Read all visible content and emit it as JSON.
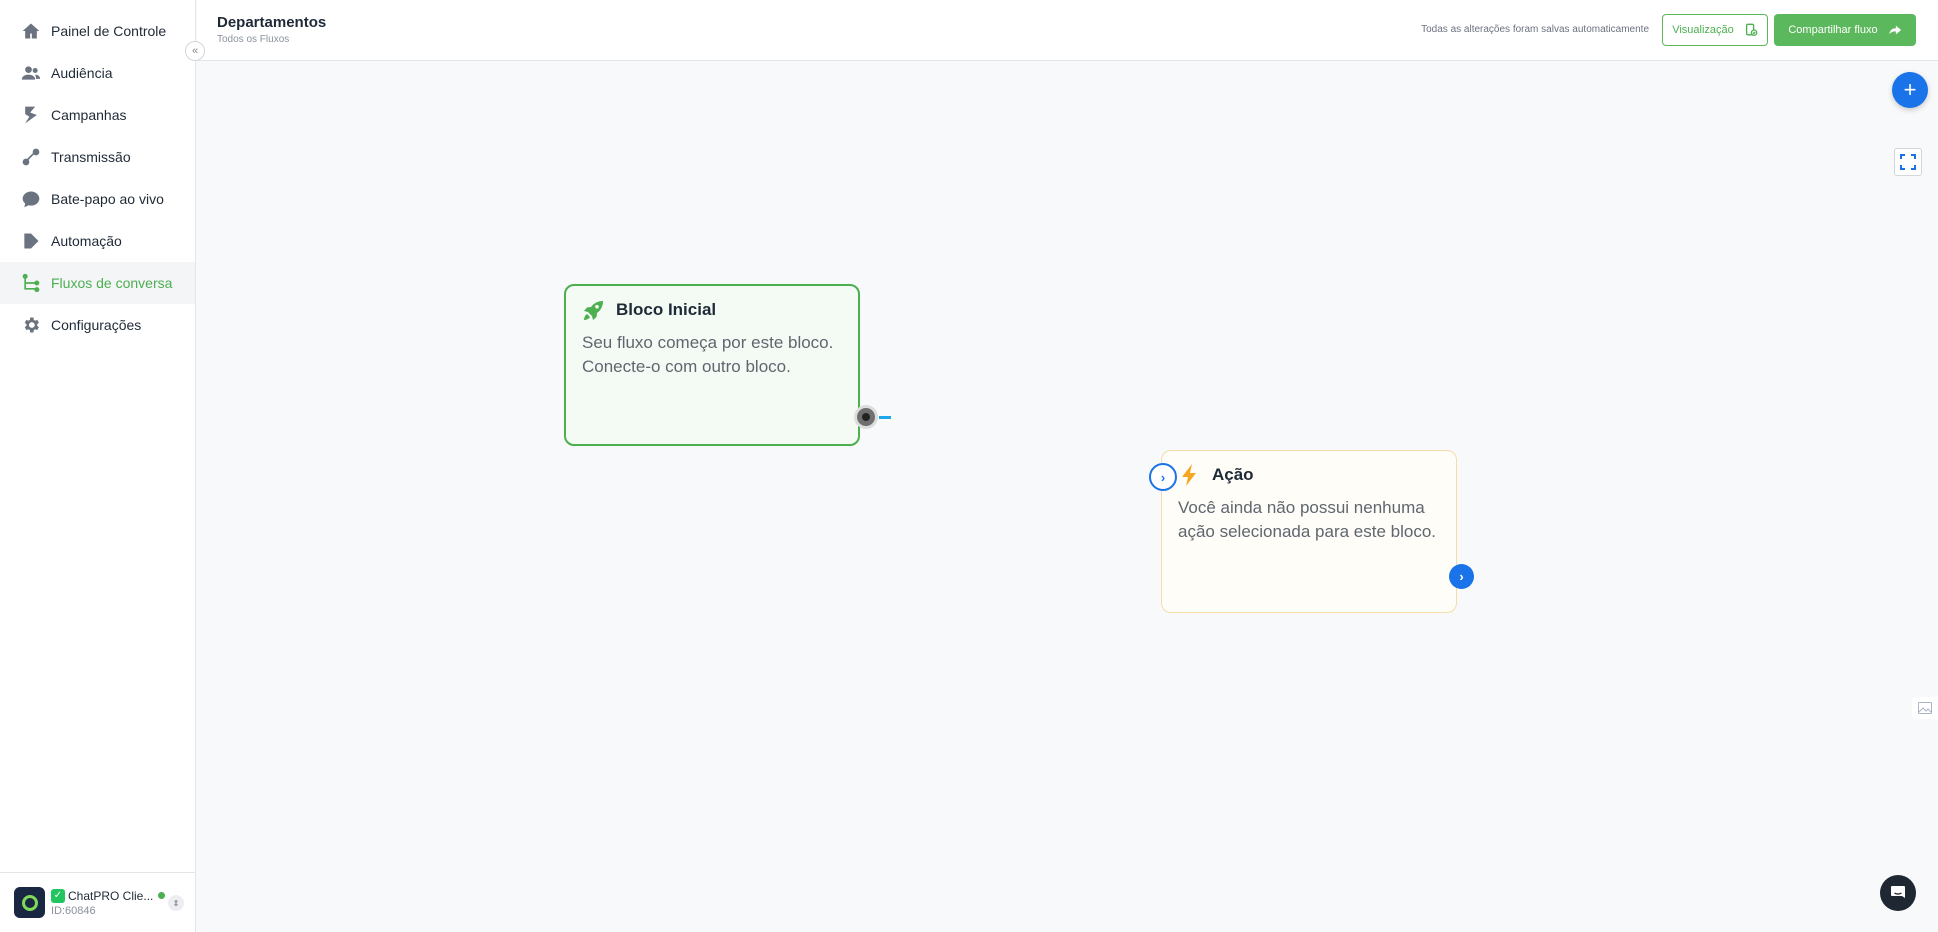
{
  "sidebar": {
    "items": [
      {
        "label": "Painel de Controle",
        "icon": "home-icon"
      },
      {
        "label": "Audiência",
        "icon": "users-icon"
      },
      {
        "label": "Campanhas",
        "icon": "campaign-icon"
      },
      {
        "label": "Transmissão",
        "icon": "broadcast-icon"
      },
      {
        "label": "Bate-papo ao vivo",
        "icon": "chat-bubble-icon"
      },
      {
        "label": "Automação",
        "icon": "automation-icon"
      },
      {
        "label": "Fluxos de conversa",
        "icon": "flow-icon",
        "active": true
      },
      {
        "label": "Configurações",
        "icon": "gear-icon"
      }
    ],
    "collapse_icon": "«",
    "account": {
      "name": "ChatPRO Clie...",
      "id": "ID:60846",
      "status_color": "#4caf50"
    }
  },
  "header": {
    "title": "Departamentos",
    "breadcrumb": "Todos os Fluxos",
    "saved_status": "Todas as alterações foram salvas automaticamente",
    "preview_label": "Visualização",
    "share_label": "Compartilhar fluxo"
  },
  "canvas": {
    "blocks": {
      "start": {
        "title": "Bloco Inicial",
        "description": "Seu fluxo começa por este bloco. Conecte-o com outro bloco.",
        "icon": "rocket-icon"
      },
      "action": {
        "title": "Ação",
        "description": "Você ainda não possui nenhuma ação selecionada para este bloco.",
        "icon": "lightning-icon"
      }
    },
    "add_label": "+",
    "port_glyph": "›"
  },
  "colors": {
    "accent_green": "#4caf50",
    "accent_blue": "#1a73e8",
    "connector": "#1ea6e8"
  }
}
